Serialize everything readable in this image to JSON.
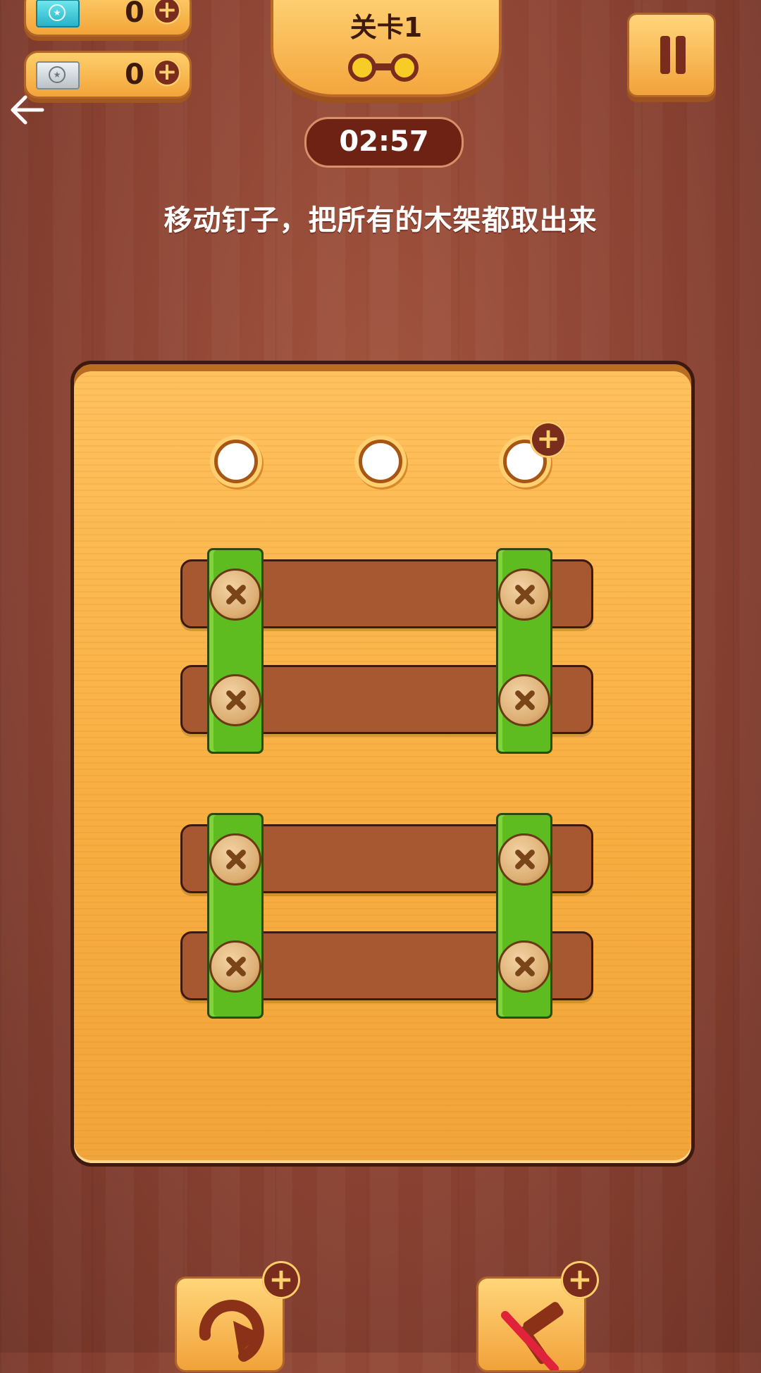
{
  "currency": [
    {
      "name": "teal-ticket",
      "count": "0",
      "color": "#28b2c7"
    },
    {
      "name": "silver-ticket",
      "count": "0",
      "color": "#b9c2c8"
    }
  ],
  "level": {
    "title": "关卡1"
  },
  "timer": "02:57",
  "instruction": "移动钉子，把所有的木架都取出来",
  "board": {
    "holes": 3,
    "planks": 4,
    "screws": 8,
    "colors": {
      "board": "#f7ad3f",
      "plank": "#a85831",
      "strap": "#5ebb20",
      "frame": "#3d1a0d"
    }
  },
  "tools": [
    {
      "name": "undo-tool"
    },
    {
      "name": "hammer-tool"
    }
  ]
}
